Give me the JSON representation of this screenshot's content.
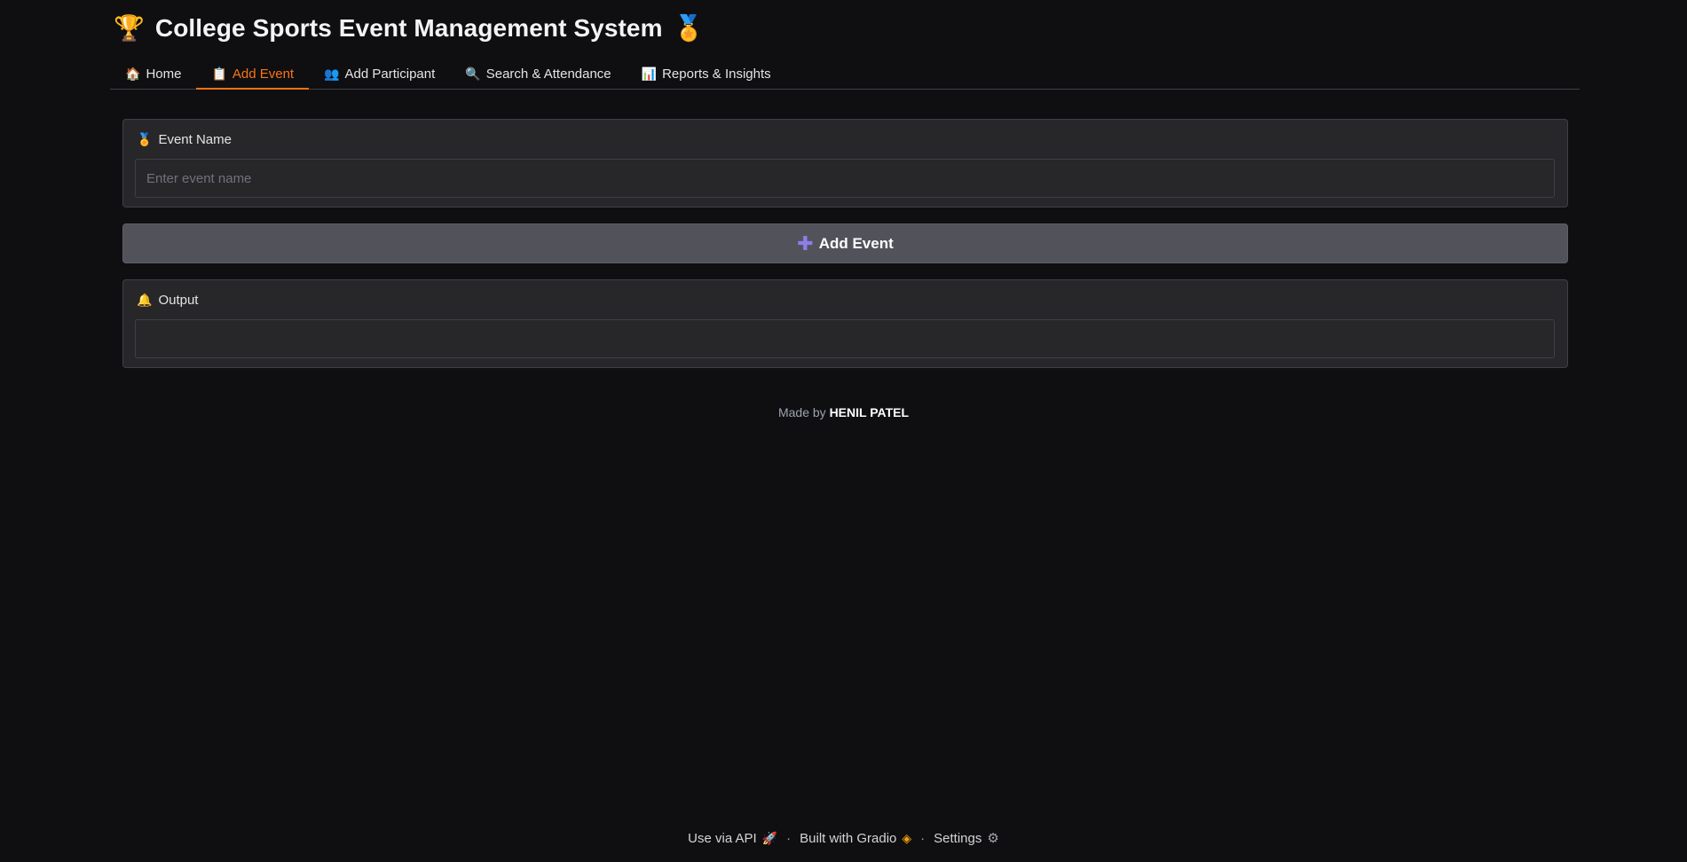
{
  "header": {
    "icon_left": "🏆",
    "title": "College Sports Event Management System",
    "icon_right": "🏅"
  },
  "tabs": [
    {
      "icon": "🏠",
      "label": "Home",
      "active": false
    },
    {
      "icon": "📋",
      "label": "Add Event",
      "active": true
    },
    {
      "icon": "👥",
      "label": "Add Participant",
      "active": false
    },
    {
      "icon": "🔍",
      "label": "Search & Attendance",
      "active": false
    },
    {
      "icon": "📊",
      "label": "Reports & Insights",
      "active": false
    }
  ],
  "event_name": {
    "icon": "🏅",
    "label": "Event Name",
    "placeholder": "Enter event name",
    "value": ""
  },
  "add_button": {
    "icon": "✚",
    "label": "Add Event"
  },
  "output": {
    "icon": "🔔",
    "label": "Output",
    "value": ""
  },
  "credit": {
    "prefix": "Made by ",
    "author": "HENIL PATEL"
  },
  "footer": {
    "api_label": "Use via API",
    "api_icon": "🚀",
    "separator": "·",
    "built_label": "Built with Gradio",
    "built_icon": "◈",
    "settings_label": "Settings",
    "settings_icon": "⚙"
  },
  "colors": {
    "background": "#0f0f11",
    "panel": "#27272a",
    "accent": "#f97316",
    "button": "#52525b"
  }
}
